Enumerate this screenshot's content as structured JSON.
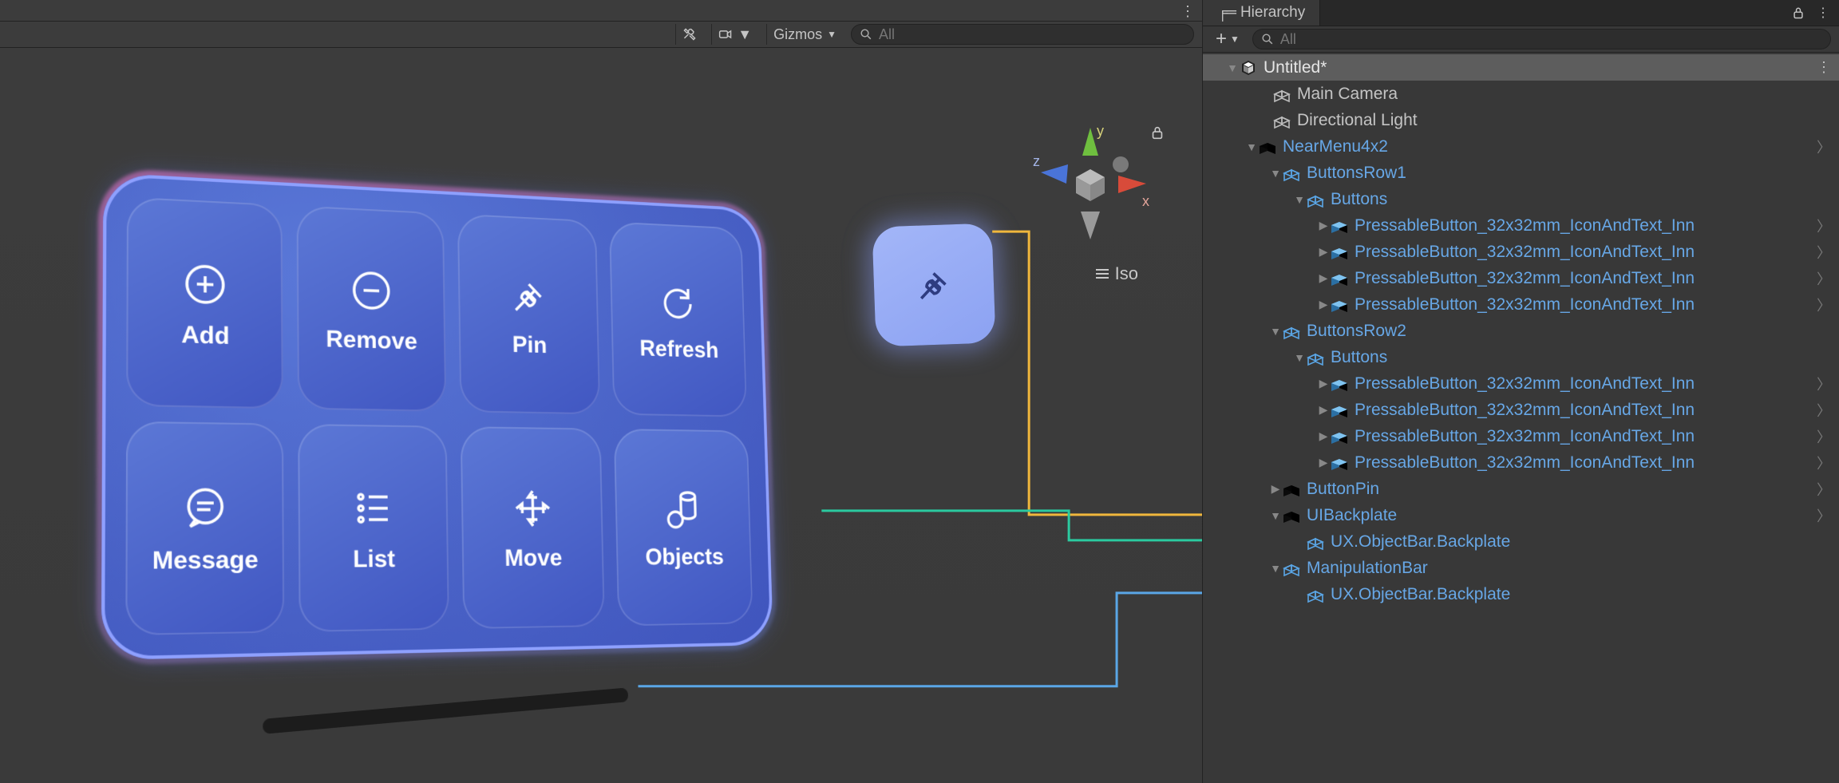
{
  "scene": {
    "toolbar": {
      "gizmos_label": "Gizmos",
      "search_placeholder": "All"
    },
    "gizmo": {
      "x": "x",
      "y": "y",
      "z": "z",
      "persp_label": "Iso"
    },
    "near_menu": {
      "buttons": [
        {
          "label": "Add",
          "icon": "plus-circle-icon"
        },
        {
          "label": "Remove",
          "icon": "minus-circle-icon"
        },
        {
          "label": "Pin",
          "icon": "pin-icon"
        },
        {
          "label": "Refresh",
          "icon": "refresh-icon"
        },
        {
          "label": "Message",
          "icon": "message-icon"
        },
        {
          "label": "List",
          "icon": "list-icon"
        },
        {
          "label": "Move",
          "icon": "move-icon"
        },
        {
          "label": "Objects",
          "icon": "objects-icon"
        }
      ]
    }
  },
  "hierarchy": {
    "tab_label": "Hierarchy",
    "search_placeholder": "All",
    "scene_name": "Untitled*",
    "items": {
      "main_camera": "Main Camera",
      "directional_light": "Directional Light",
      "near_menu": "NearMenu4x2",
      "buttons_row1": "ButtonsRow1",
      "buttons_row2": "ButtonsRow2",
      "buttons": "Buttons",
      "pressable": "PressableButton_32x32mm_IconAndText_Inn",
      "button_pin": "ButtonPin",
      "ui_backplate": "UIBackplate",
      "ux_backplate": "UX.ObjectBar.Backplate",
      "manipulation_bar": "ManipulationBar"
    }
  }
}
